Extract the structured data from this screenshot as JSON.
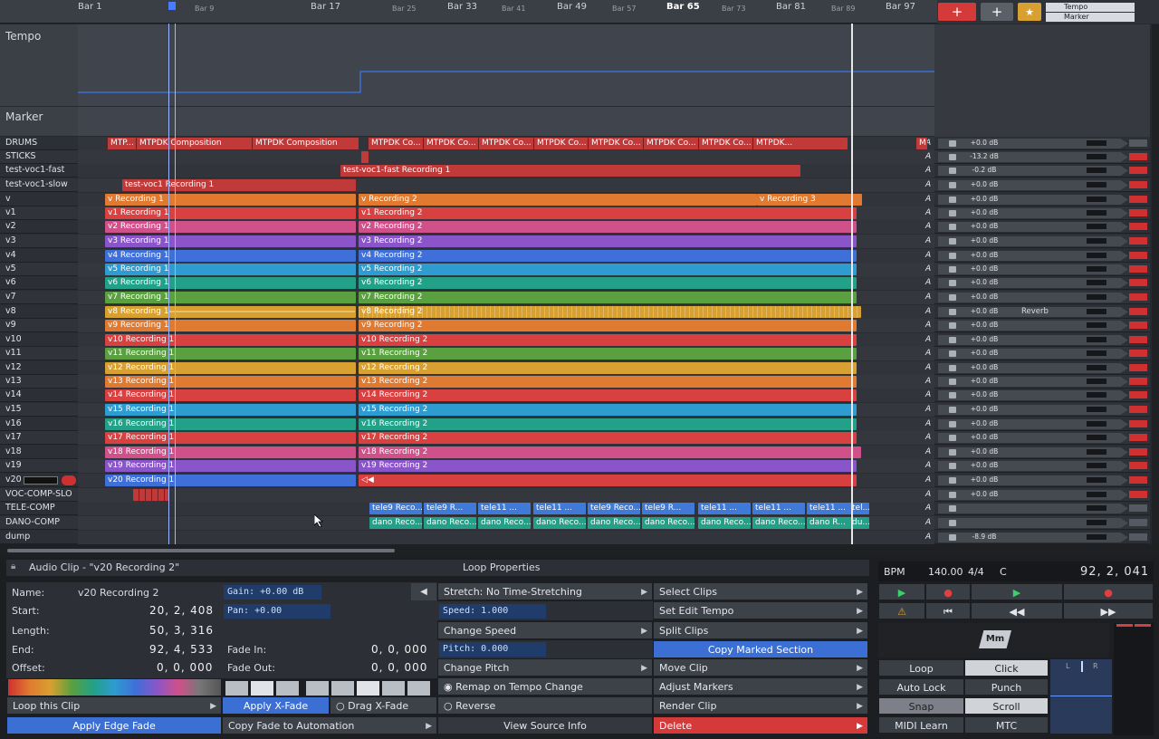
{
  "ruler": {
    "bars": [
      "Bar 1",
      "Bar 9",
      "Bar 17",
      "Bar 25",
      "Bar 33",
      "Bar 41",
      "Bar 49",
      "Bar 57",
      "Bar 65",
      "Bar 73",
      "Bar 81",
      "Bar 89",
      "Bar 97"
    ],
    "mini": {
      "tempo": "Tempo",
      "marker": "Marker"
    }
  },
  "lanes": {
    "tempo": "Tempo",
    "tempo_sig": [
      "4",
      "4",
      "C"
    ],
    "marker": "Marker"
  },
  "tracks": [
    {
      "name": "DRUMS",
      "gain": "+0.0 dB",
      "prefix": "M"
    },
    {
      "name": "STICKS",
      "gain": "-13.2 dB"
    },
    {
      "name": "test-voc1-fast",
      "gain": "-0.2 dB"
    },
    {
      "name": "test-voc1-slow",
      "gain": "+0.0 dB"
    },
    {
      "name": "v",
      "gain": "+0.0 dB"
    },
    {
      "name": "v1",
      "gain": "+0.0 dB"
    },
    {
      "name": "v2",
      "gain": "+0.0 dB"
    },
    {
      "name": "v3",
      "gain": "+0.0 dB"
    },
    {
      "name": "v4",
      "gain": "+0.0 dB"
    },
    {
      "name": "v5",
      "gain": "+0.0 dB"
    },
    {
      "name": "v6",
      "gain": "+0.0 dB"
    },
    {
      "name": "v7",
      "gain": "+0.0 dB"
    },
    {
      "name": "v8",
      "gain": "+0.0 dB",
      "plugin": "Reverb"
    },
    {
      "name": "v9",
      "gain": "+0.0 dB"
    },
    {
      "name": "v10",
      "gain": "+0.0 dB"
    },
    {
      "name": "v11",
      "gain": "+0.0 dB"
    },
    {
      "name": "v12",
      "gain": "+0.0 dB"
    },
    {
      "name": "v13",
      "gain": "+0.0 dB"
    },
    {
      "name": "v14",
      "gain": "+0.0 dB"
    },
    {
      "name": "v15",
      "gain": "+0.0 dB"
    },
    {
      "name": "v16",
      "gain": "+0.0 dB"
    },
    {
      "name": "v17",
      "gain": "+0.0 dB"
    },
    {
      "name": "v18",
      "gain": "+0.0 dB"
    },
    {
      "name": "v19",
      "gain": "+0.0 dB"
    },
    {
      "name": "v20",
      "gain": "+0.0 dB"
    },
    {
      "name": "VOC-COMP-SLO",
      "gain": "+0.0 dB"
    },
    {
      "name": "TELE-COMP",
      "gain": ""
    },
    {
      "name": "DANO-COMP",
      "gain": ""
    },
    {
      "name": "dump",
      "gain": "-8.9 dB"
    }
  ],
  "clips": {
    "drums": [
      "MTP...",
      "MTPDK Composition",
      "MTPDK Composition",
      "MTPDK Co...",
      "MTPDK Co...",
      "MTPDK Co...",
      "MTPDK Co...",
      "MTPDK Co...",
      "MTPDK Co...",
      "MTPDK Co...",
      "MTPDK..."
    ],
    "fast": "test-voc1-fast Recording 1",
    "slow": "test-voc1 Recording 1",
    "v": [
      "v Recording 1",
      "v Recording 2",
      "v Recording 3"
    ],
    "tele": [
      "tele9 Reco...",
      "tele9 R...",
      "tele11 ...",
      "tele11 ...",
      "tele9 Reco...",
      "tele9 R...",
      "tele11 ...",
      "tele11 ...",
      "tele11 ...",
      "tel..."
    ],
    "dano": [
      "dano Reco...",
      "dano Reco...",
      "dano Reco...",
      "dano Reco...",
      "dano Reco...",
      "dano Reco...",
      "dano Reco...",
      "dano Reco...",
      "dano R...",
      "du..."
    ]
  },
  "clip_props": {
    "title": "Audio Clip - \"v20 Recording 2\"",
    "name_label": "Name:",
    "name": "v20 Recording 2",
    "start_label": "Start:",
    "start": "20, 2, 408",
    "length_label": "Length:",
    "length": "50, 3, 316",
    "end_label": "End:",
    "end": "92, 4, 533",
    "offset_label": "Offset:",
    "offset": "0, 0, 000",
    "gain": "Gain: +0.00 dB",
    "pan": "Pan: +0.00",
    "fade_in_label": "Fade In:",
    "fade_in": "0, 0, 000",
    "fade_out_label": "Fade Out:",
    "fade_out": "0, 0, 000",
    "loop_this_clip": "Loop this Clip",
    "apply_xfade": "Apply X-Fade",
    "drag_xfade": "Drag X-Fade",
    "apply_edge_fade": "Apply Edge Fade",
    "copy_fade": "Copy Fade to Automation"
  },
  "loop_props": {
    "title": "Loop Properties",
    "stretch": "Stretch: No Time-Stretching",
    "speed": "Speed: 1.000",
    "change_speed": "Change Speed",
    "pitch": "Pitch: 0.000",
    "change_pitch": "Change Pitch",
    "remap": "Remap on Tempo Change",
    "reverse": "Reverse",
    "view_source": "View Source Info"
  },
  "actions": {
    "select_clips": "Select Clips",
    "set_edit_tempo": "Set Edit Tempo",
    "split_clips": "Split Clips",
    "copy_marked": "Copy Marked Section",
    "move_clip": "Move Clip",
    "adjust_markers": "Adjust Markers",
    "render_clip": "Render Clip",
    "delete": "Delete"
  },
  "transport": {
    "bpm_label": "BPM",
    "bpm": "140.00",
    "sig": "4/4",
    "key": "C",
    "position": "92, 2, 041",
    "mm": "Mm",
    "loop": "Loop",
    "click": "Click",
    "auto_lock": "Auto Lock",
    "punch": "Punch",
    "snap": "Snap",
    "scroll": "Scroll",
    "midi_learn": "MIDI Learn",
    "mtc": "MTC",
    "meter_l": "L",
    "meter_r": "R"
  },
  "colors": {
    "red": "#d94040",
    "orange": "#e07a30",
    "pink": "#d0508a",
    "purple": "#8a55c8",
    "blue": "#3f6fd8",
    "cyan": "#2e9cd0",
    "teal": "#22a088",
    "green": "#5aa040",
    "gold": "#d8a030",
    "accent": "#3c6fd4"
  }
}
